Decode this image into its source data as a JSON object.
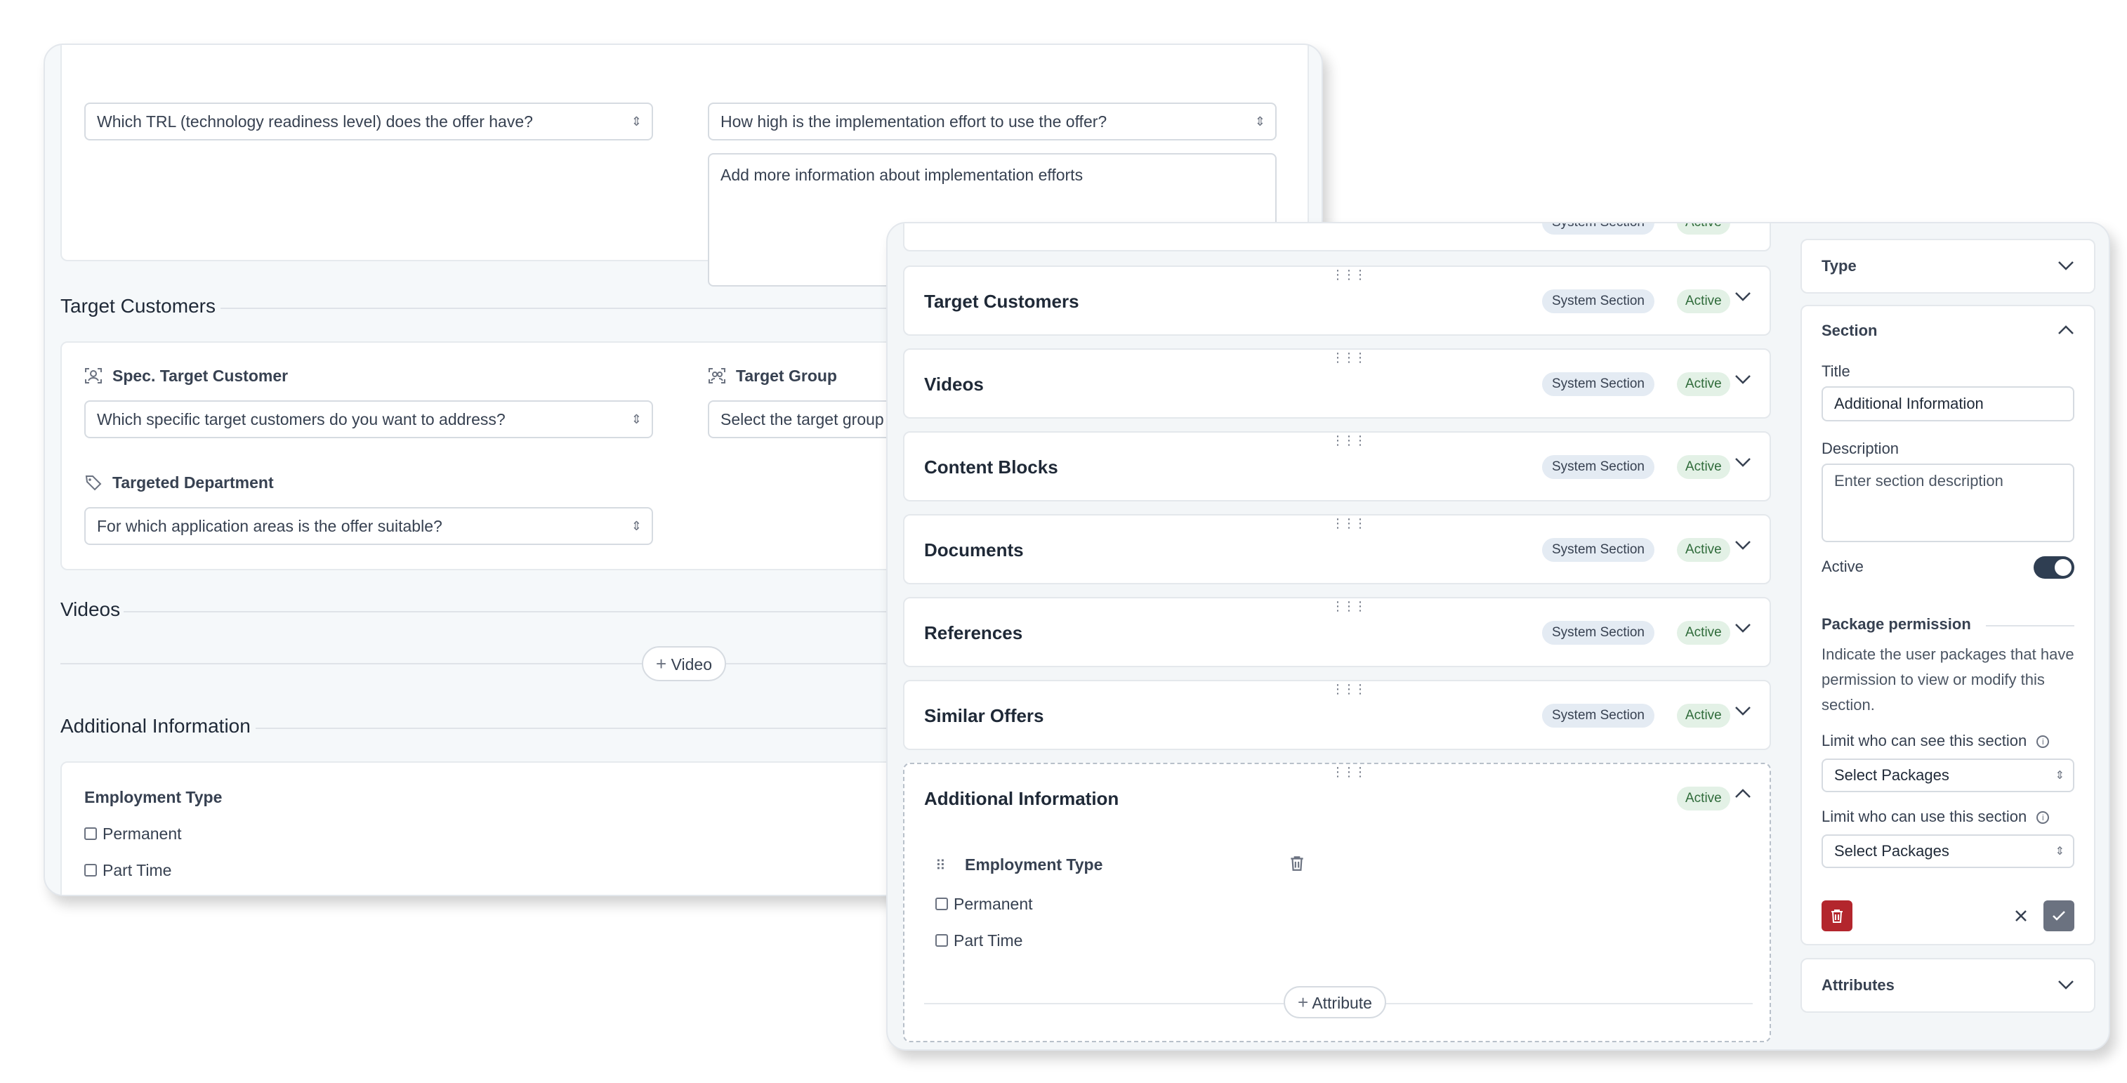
{
  "back_form": {
    "top": {
      "trl_select": "Which TRL (technology readiness level) does the offer have?",
      "effort_select": "How high is the implementation effort to use the offer?",
      "effort_textarea": "Add more information about implementation efforts"
    },
    "target_customers": {
      "title": "Target Customers",
      "spec_label": "Spec. Target Customer",
      "spec_select": "Which specific target customers do you want to address?",
      "group_label": "Target Group",
      "group_select": "Select the target group yo",
      "dept_label": "Targeted Department",
      "dept_select": "For which application areas is the offer suitable?"
    },
    "videos": {
      "title": "Videos",
      "add_button": "Video"
    },
    "additional": {
      "title": "Additional Information",
      "field_label": "Employment Type",
      "options": [
        "Permanent",
        "Part Time"
      ]
    }
  },
  "sections_editor": {
    "tags": {
      "system": "System Section",
      "active": "Active"
    },
    "rows": [
      {
        "title": "Target Customers"
      },
      {
        "title": "Videos"
      },
      {
        "title": "Content Blocks"
      },
      {
        "title": "Documents"
      },
      {
        "title": "References"
      },
      {
        "title": "Similar Offers"
      }
    ],
    "expanded": {
      "title": "Additional Information",
      "field_label": "Employment Type",
      "options": [
        "Permanent",
        "Part Time"
      ],
      "add_button": "Attribute"
    }
  },
  "sidebar": {
    "type_label": "Type",
    "section_label": "Section",
    "title_label": "Title",
    "title_value": "Additional Information",
    "description_label": "Description",
    "description_placeholder": "Enter section description",
    "active_label": "Active",
    "active_on": true,
    "permission_heading": "Package permission",
    "permission_text": "Indicate the user packages that have permission to view or modify this section.",
    "see_label": "Limit who can see this section",
    "see_select": "Select Packages",
    "use_label": "Limit who can use this section",
    "use_select": "Select Packages",
    "attributes_label": "Attributes"
  },
  "colors": {
    "delete_red": "#b3262d",
    "confirm_gray": "#6b7280",
    "toggle_on": "#2f3e52",
    "system_tag_bg": "#e4ebf3",
    "active_tag_bg": "#e3f1e6"
  }
}
